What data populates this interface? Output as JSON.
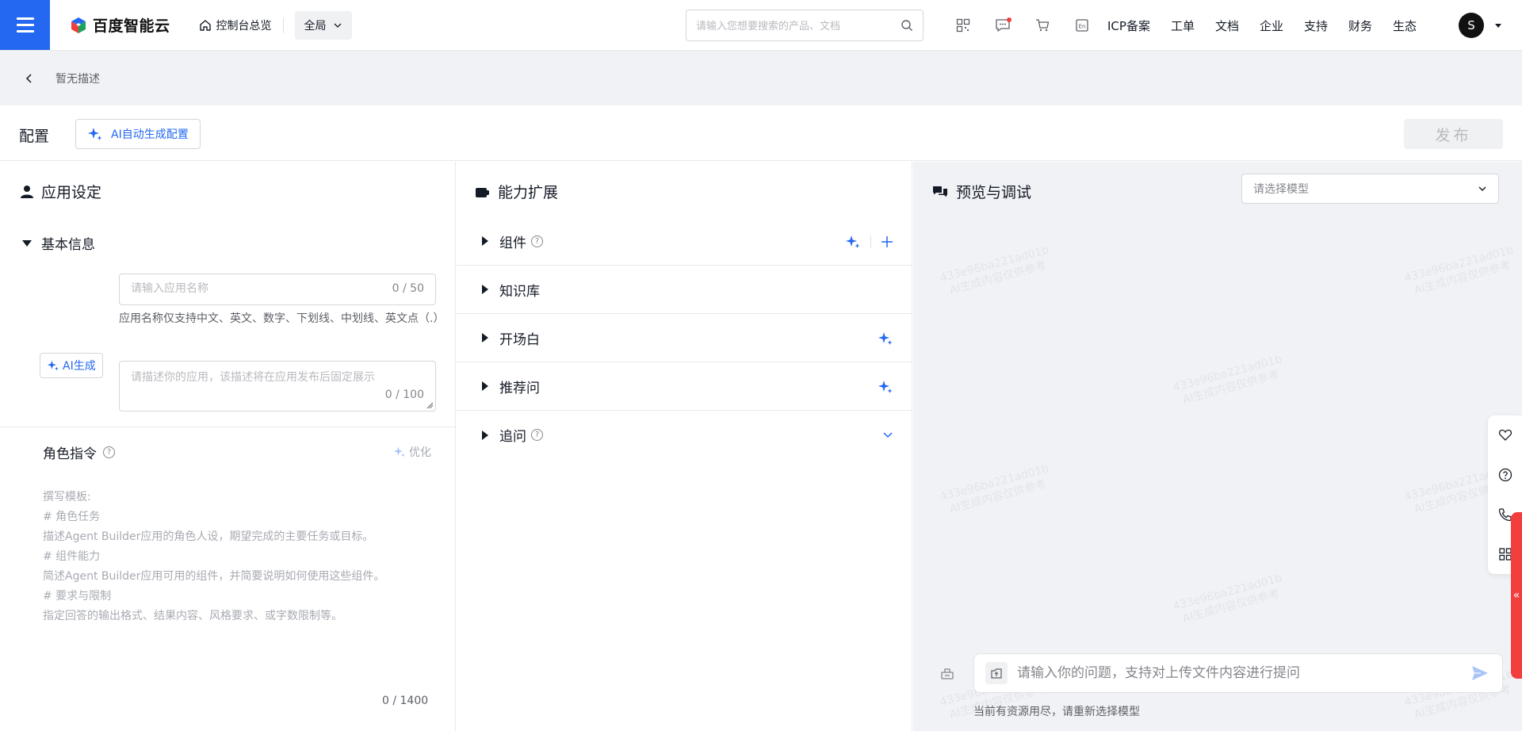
{
  "nav": {
    "logo_text": "百度智能云",
    "console_label": "控制台总览",
    "region": "全局",
    "search_placeholder": "请输入您想要搜索的产品、文档",
    "links": [
      "ICP备案",
      "工单",
      "文档",
      "企业",
      "支持",
      "财务",
      "生态"
    ],
    "avatar_initial": "S",
    "icons": [
      "qrcode-icon",
      "message-icon",
      "cart-icon",
      "language-icon"
    ]
  },
  "breadcrumb": {
    "text": "暂无描述"
  },
  "config": {
    "title": "配置",
    "ai_generate_label": "AI自动生成配置",
    "publish_label": "发布"
  },
  "left": {
    "title": "应用设定",
    "basic_info": "基本信息",
    "name_placeholder": "请输入应用名称",
    "name_count": "0 / 50",
    "name_hint": "应用名称仅支持中文、英文、数字、下划线、中划线、英文点（.）",
    "desc_placeholder": "请描述你的应用，该描述将在应用发布后固定展示",
    "desc_count": "0 / 100",
    "ai_button": "AI生成",
    "role_title": "角色指令",
    "optimize_label": "优化",
    "template_lines": [
      "撰写模板:",
      "# 角色任务",
      "描述Agent Builder应用的角色人设，期望完成的主要任务或目标。",
      "# 组件能力",
      "简述Agent Builder应用可用的组件，并简要说明如何使用这些组件。",
      "# 要求与限制",
      "指定回答的输出格式、结果内容、风格要求、或字数限制等。"
    ],
    "role_count": "0 / 1400"
  },
  "mid": {
    "title": "能力扩展",
    "sections": [
      {
        "label": "组件",
        "help": true
      },
      {
        "label": "知识库",
        "help": false
      },
      {
        "label": "开场白",
        "help": false
      },
      {
        "label": "推荐问",
        "help": false
      },
      {
        "label": "追问",
        "help": true
      }
    ]
  },
  "right": {
    "title": "预览与调试",
    "model_placeholder": "请选择模型",
    "watermark_id": "433e96ba221ad01b",
    "watermark_text": "AI生成内容仅供参考",
    "chat_placeholder": "请输入你的问题，支持对上传文件内容进行提问",
    "status": "当前有资源用尽，请重新选择模型"
  },
  "colors": {
    "primary": "#2468f2",
    "danger": "#f33e3e",
    "bg_gray": "#f0f2f5"
  }
}
